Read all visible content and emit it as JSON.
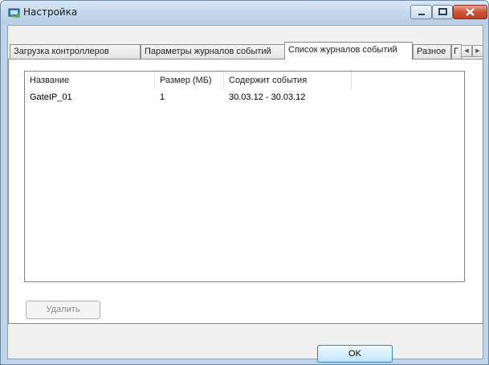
{
  "window": {
    "title": "Настройка",
    "controls": {
      "minimize": "minimize-icon",
      "maximize": "maximize-icon",
      "close": "close-icon"
    }
  },
  "tabs": [
    {
      "label": "Загрузка контроллеров",
      "active": false
    },
    {
      "label": "Параметры журналов событий",
      "active": false
    },
    {
      "label": "Список журналов событий",
      "active": true
    },
    {
      "label": "Разное",
      "active": false
    },
    {
      "label": "Г",
      "active": false
    }
  ],
  "list": {
    "columns": [
      "Название",
      "Размер (МБ)",
      "Содержит события"
    ],
    "rows": [
      {
        "name": "GateIP_01",
        "size": "1",
        "events": "30.03.12 - 30.03.12"
      }
    ]
  },
  "buttons": {
    "delete": "Удалить",
    "ok": "OK"
  },
  "colors": {
    "accent": "#3c7fb1",
    "close": "#c13e22"
  }
}
